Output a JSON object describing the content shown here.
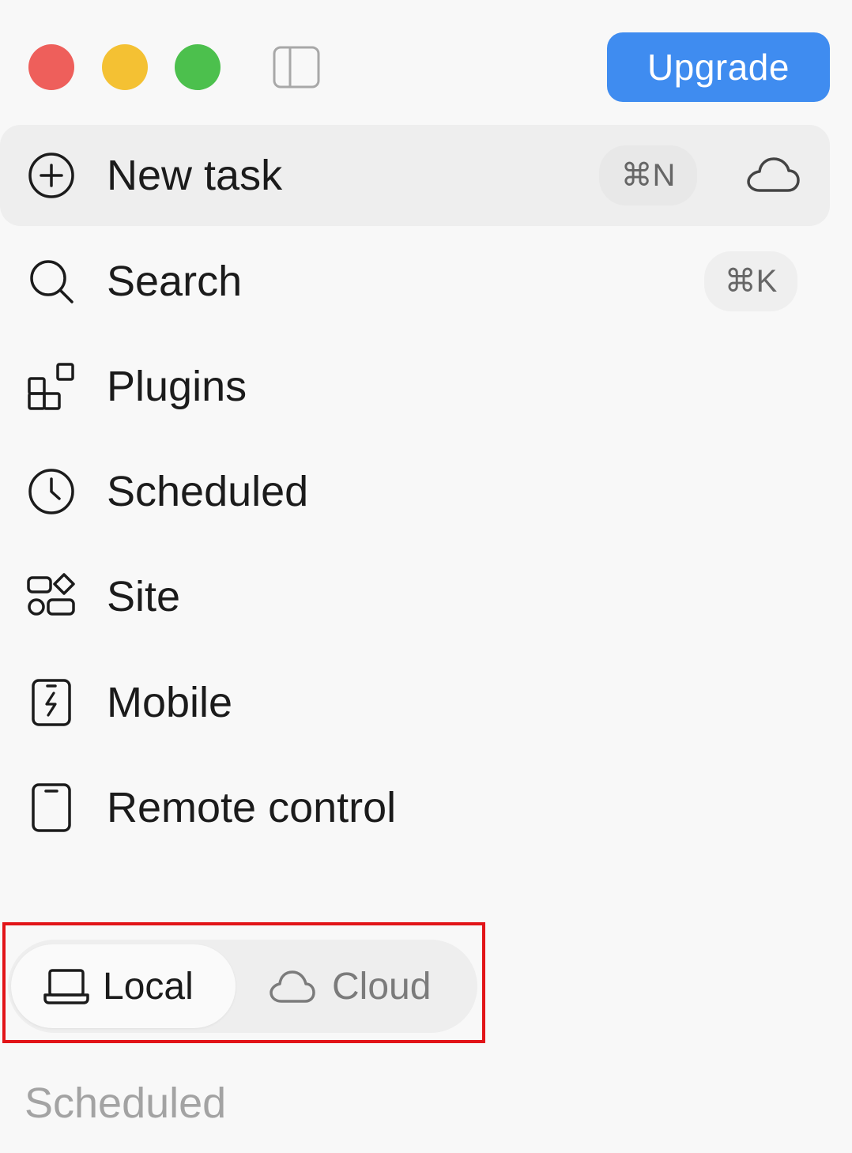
{
  "window": {
    "controls": [
      "close",
      "minimize",
      "maximize"
    ],
    "sidebar_toggle_icon": "sidebar-toggle-icon"
  },
  "header": {
    "upgrade_label": "Upgrade"
  },
  "nav": {
    "new_task": {
      "label": "New task",
      "shortcut": "⌘N",
      "icon": "plus-circle-icon",
      "trailing_icon": "cloud-icon"
    },
    "search": {
      "label": "Search",
      "shortcut": "⌘K",
      "icon": "search-icon"
    },
    "plugins": {
      "label": "Plugins",
      "icon": "plugins-icon"
    },
    "scheduled": {
      "label": "Scheduled",
      "icon": "clock-icon"
    },
    "site": {
      "label": "Site",
      "icon": "site-icon"
    },
    "mobile": {
      "label": "Mobile",
      "icon": "mobile-icon"
    },
    "remote_control": {
      "label": "Remote control",
      "icon": "tablet-icon"
    }
  },
  "mode_switch": {
    "selected": "Local",
    "options": [
      {
        "label": "Local",
        "icon": "laptop-icon"
      },
      {
        "label": "Cloud",
        "icon": "cloud-icon"
      }
    ]
  },
  "section": {
    "heading": "Scheduled"
  },
  "colors": {
    "background": "#f8f8f8",
    "accent": "#3f8cf0",
    "close": "#ee5f5b",
    "minimize": "#f4c133",
    "maximize": "#4cc04d",
    "highlight": "#e21418",
    "muted_text": "#a3a3a3"
  }
}
